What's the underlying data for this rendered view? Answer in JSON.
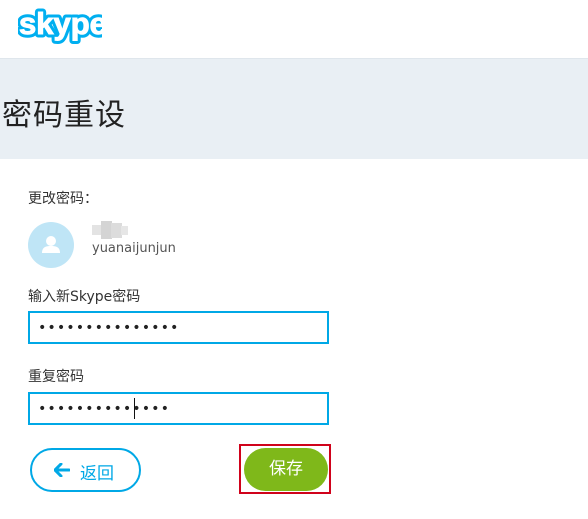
{
  "brand": {
    "logo_text": "skype",
    "logo_color": "#00aff0",
    "logo_icon": "skype-logo"
  },
  "header": {
    "title": "密码重设"
  },
  "account": {
    "section_label": "更改密码：",
    "avatar_icon": "user-avatar-icon",
    "username": "yuanaijunjun"
  },
  "form": {
    "new_password_label": "输入新Skype密码",
    "new_password_value": "•••••••••••••••",
    "repeat_password_label": "重复密码",
    "repeat_password_value": "••••••••••••••"
  },
  "actions": {
    "back_label": "返回",
    "back_icon": "arrow-left-icon",
    "save_label": "保存"
  },
  "colors": {
    "accent": "#00a8e6",
    "save_button": "#7fb81a",
    "highlight": "#d0021b",
    "title_band": "#e9eff4"
  }
}
